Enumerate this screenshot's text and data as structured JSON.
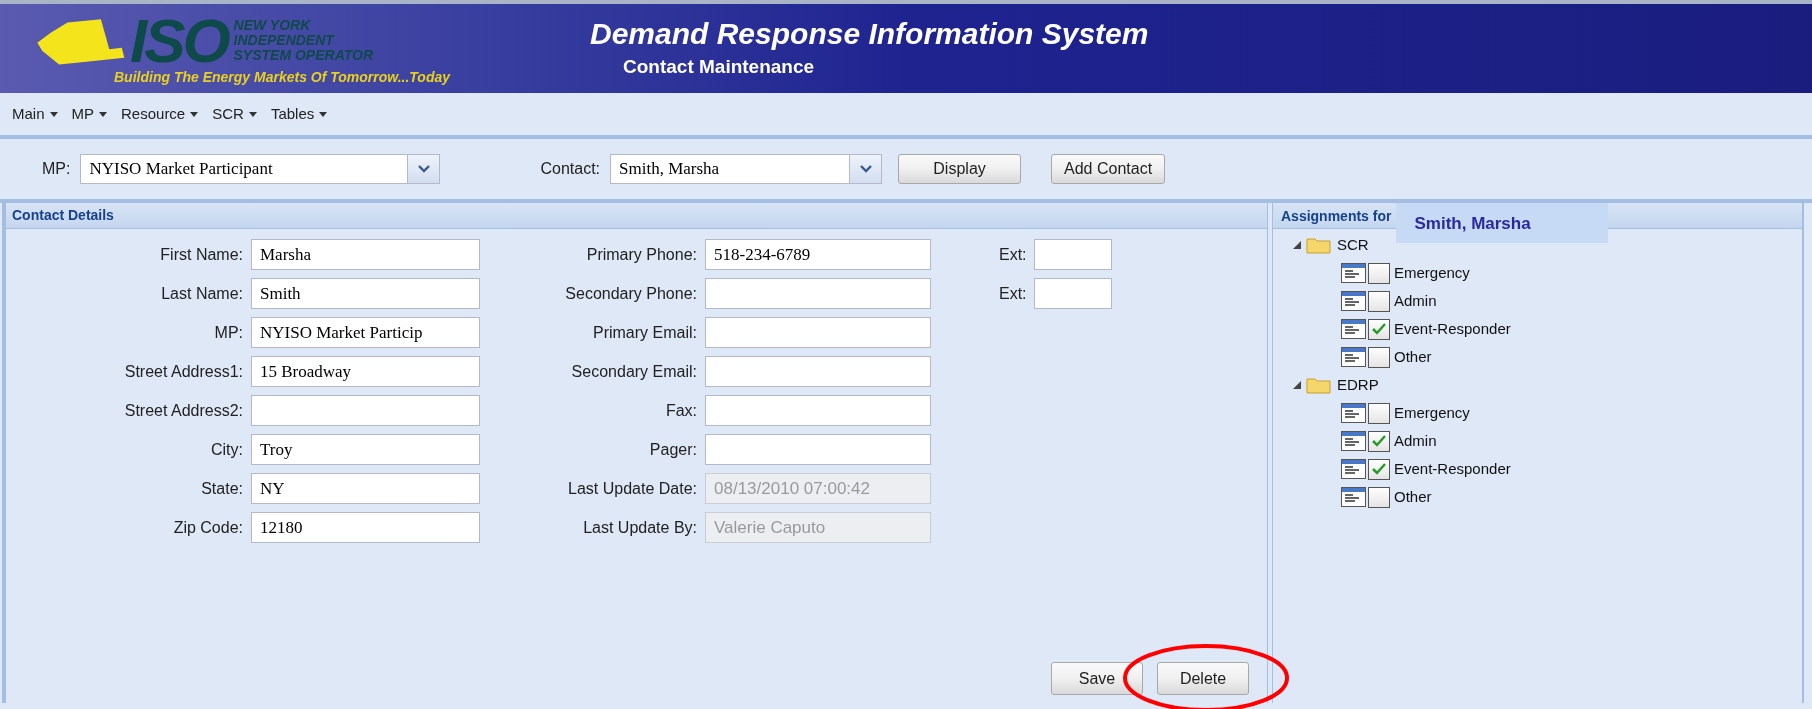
{
  "header": {
    "logo_letters": "ISO",
    "logo_lines": [
      "NEW YORK",
      "INDEPENDENT",
      "SYSTEM OPERATOR"
    ],
    "tagline": "Building The Energy Markets Of Tomorrow...Today",
    "title": "Demand Response Information System",
    "subtitle": "Contact Maintenance"
  },
  "menu": [
    "Main",
    "MP",
    "Resource",
    "SCR",
    "Tables"
  ],
  "toolbar": {
    "mp_label": "MP:",
    "mp_value": "NYISO Market Participant",
    "contact_label": "Contact:",
    "contact_value": "Smith, Marsha",
    "buttons": [
      "Display",
      "Add Contact"
    ]
  },
  "contact_details": {
    "title": "Contact Details",
    "column_1": [
      {
        "label": "First Name:",
        "value": "Marsha",
        "disabled": false
      },
      {
        "label": "Last Name:",
        "value": "Smith",
        "disabled": false
      },
      {
        "label": "MP:",
        "value": "NYISO Market Particip",
        "disabled": false
      },
      {
        "label": "Street Address1:",
        "value": "15 Broadway",
        "disabled": false
      },
      {
        "label": "Street Address2:",
        "disabled": false
      },
      {
        "label": "City:",
        "value": "Troy",
        "disabled": false
      },
      {
        "label": "State:",
        "value": "NY",
        "disabled": false
      },
      {
        "label": "Zip Code:",
        "value": "12180",
        "disabled": false
      }
    ],
    "column_2": [
      {
        "label": "Primary Phone:",
        "value": "518-234-6789",
        "disabled": false,
        "ext_label": "Ext:"
      },
      {
        "label": "Secondary Phone:",
        "disabled": false,
        "ext_label": "Ext:"
      },
      {
        "label": "Primary Email:",
        "disabled": false
      },
      {
        "label": "Secondary Email:",
        "disabled": false
      },
      {
        "label": "Fax:",
        "disabled": false
      },
      {
        "label": "Pager:",
        "disabled": false
      },
      {
        "label": "Last Update Date:",
        "value": "08/13/2010 07:00:42",
        "disabled": true
      },
      {
        "label": "Last Update By:",
        "value": "Valerie Caputo",
        "disabled": true
      }
    ],
    "buttons": [
      {
        "label": "Save",
        "highlighted": false
      },
      {
        "label": "Delete",
        "highlighted": true
      }
    ]
  },
  "assignments": {
    "title": "Assignments for",
    "contact": "Smith, Marsha",
    "tree": [
      {
        "label": "SCR",
        "expanded": true,
        "children": [
          {
            "label": "Emergency",
            "checked": false
          },
          {
            "label": "Admin",
            "checked": false
          },
          {
            "label": "Event-Responder",
            "checked": true
          },
          {
            "label": "Other",
            "checked": false
          }
        ]
      },
      {
        "label": "EDRP",
        "expanded": true,
        "children": [
          {
            "label": "Emergency",
            "checked": false
          },
          {
            "label": "Admin",
            "checked": true
          },
          {
            "label": "Event-Responder",
            "checked": true
          },
          {
            "label": "Other",
            "checked": false
          }
        ]
      }
    ]
  }
}
